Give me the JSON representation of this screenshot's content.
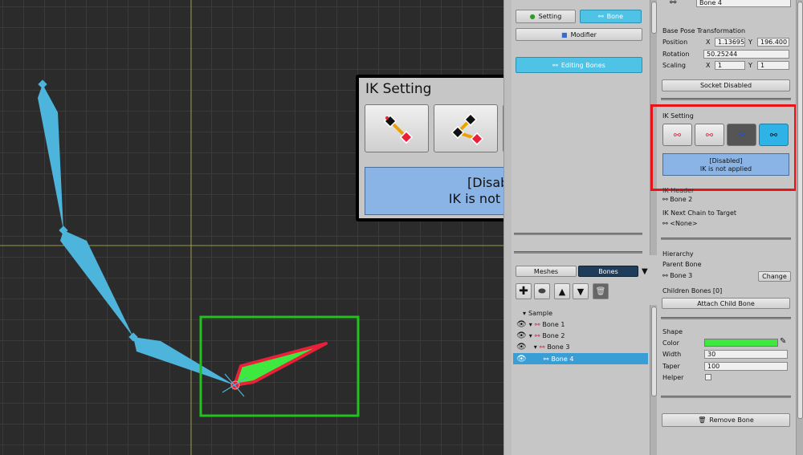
{
  "viewport": {},
  "mid_panel": {
    "setting_label": "Setting",
    "bone_label": "Bone",
    "modifier_label": "Modifier",
    "editing_bones_label": "Editing Bones",
    "meshes_tab": "Meshes",
    "bones_tab": "Bones",
    "tree": [
      {
        "label": "Sample",
        "level": 0
      },
      {
        "label": "Bone 1",
        "level": 1
      },
      {
        "label": "Bone 2",
        "level": 1
      },
      {
        "label": "Bone 3",
        "level": 2
      },
      {
        "label": "Bone 4",
        "level": 3
      }
    ]
  },
  "popup": {
    "title": "IK Setting",
    "status_line1": "[Disabled]",
    "status_line2": "IK is not applied"
  },
  "right_panel": {
    "bone_name": "Bone 4",
    "base_pose_title": "Base Pose Transformation",
    "position_label": "Position",
    "x_label": "X",
    "y_label": "Y",
    "position_x": "1.13695",
    "position_y": "196.400",
    "rotation_label": "Rotation",
    "rotation_value": "50.25244",
    "scaling_label": "Scaling",
    "scaling_x": "1",
    "scaling_y": "1",
    "socket_button": "Socket Disabled",
    "ik_setting_title": "IK Setting",
    "ik_status_line1": "[Disabled]",
    "ik_status_line2": "IK is not applied",
    "ik_header_partial": "IK Header",
    "ik_header_value": "Bone 2",
    "ik_next_chain_label": "IK Next Chain to Target",
    "ik_next_chain_value": "<None>",
    "hierarchy_label": "Hierarchy",
    "parent_bone_label": "Parent Bone",
    "parent_bone_value": "Bone 3",
    "change_button": "Change",
    "children_label": "Children Bones [0]",
    "attach_child_button": "Attach Child Bone",
    "shape_label": "Shape",
    "color_label": "Color",
    "color_value": "#3ee83e",
    "width_label": "Width",
    "width_value": "30",
    "taper_label": "Taper",
    "taper_value": "100",
    "helper_label": "Helper",
    "remove_bone_button": "Remove Bone"
  },
  "colors": {
    "accent": "#4ec3e6",
    "bone_blue": "#4db5dc",
    "selected_bone": "#3ee83e",
    "selection_outline": "#e8203a",
    "green_frame": "#21c21f",
    "red_frame": "#e8141c",
    "ik_status_bg": "#8ab4e6"
  }
}
